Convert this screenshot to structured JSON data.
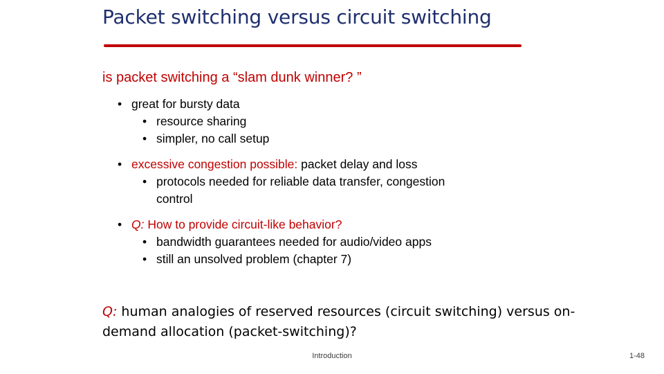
{
  "slide": {
    "title": "Packet switching versus circuit switching",
    "subhead": "is packet switching a “slam dunk winner? ”",
    "bullets": {
      "b1": "great for bursty data",
      "b1a": "resource sharing",
      "b1b": "simpler, no call setup",
      "b2_red": "excessive congestion possible:",
      "b2_rest": " packet delay and loss",
      "b2a": "protocols needed for reliable data transfer, congestion",
      "b2a_cont": "control",
      "b3_q": "Q:",
      "b3_rest": " How to provide circuit-like behavior?",
      "b3a": "bandwidth guarantees needed for audio/video apps",
      "b3b": "still an unsolved problem (chapter 7)"
    },
    "closing": {
      "q": "Q:",
      "text": "  human analogies of reserved resources (circuit switching) versus on-demand allocation (packet-switching)?"
    },
    "footer": {
      "center": "Introduction",
      "page": "1-48"
    },
    "bullet_glyph": "•",
    "colors": {
      "title": "#1f2f6e",
      "accent": "#c00000",
      "body": "#000000"
    }
  }
}
